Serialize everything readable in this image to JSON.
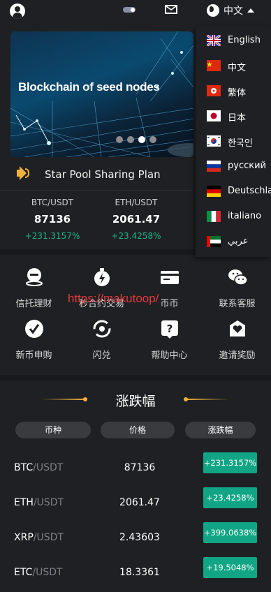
{
  "header": {
    "language_current": "中文"
  },
  "banner": {
    "title": "Blockchain of seed nodes"
  },
  "notice": {
    "text": "Star Pool Sharing Plan"
  },
  "tickers": [
    {
      "pair": "BTC/USDT",
      "price": "87136",
      "change": "+231.3157%"
    },
    {
      "pair": "ETH/USDT",
      "price": "2061.47",
      "change": "+23.4258%"
    }
  ],
  "menu": [
    {
      "label": "信托理财",
      "icon": "trust-finance-icon"
    },
    {
      "label": "秒合约交易",
      "icon": "stopwatch-icon"
    },
    {
      "label": "币币",
      "icon": "card-icon"
    },
    {
      "label": "联系客服",
      "icon": "wechat-icon"
    },
    {
      "label": "新币申购",
      "icon": "check-circle-icon"
    },
    {
      "label": "闪兑",
      "icon": "refresh-icon"
    },
    {
      "label": "帮助中心",
      "icon": "help-icon"
    },
    {
      "label": "邀请奖励",
      "icon": "invite-heart-icon"
    }
  ],
  "watermark": "https://makutoop/",
  "market": {
    "title": "涨跌幅",
    "headers": [
      "币种",
      "价格",
      "涨跌幅"
    ],
    "rows": [
      {
        "base": "BTC",
        "quote": "/USDT",
        "price": "87136",
        "change": "+231.3157%"
      },
      {
        "base": "ETH",
        "quote": "/USDT",
        "price": "2061.47",
        "change": "+23.4258%"
      },
      {
        "base": "XRP",
        "quote": "/USDT",
        "price": "2.43603",
        "change": "+399.0638%"
      },
      {
        "base": "ETC",
        "quote": "/USDT",
        "price": "18.3361",
        "change": "+19.5048%"
      }
    ]
  },
  "languages": [
    {
      "name": "English",
      "flag": "uk-flag"
    },
    {
      "name": "中文",
      "flag": "china-flag"
    },
    {
      "name": "繁体",
      "flag": "hong-kong-flag"
    },
    {
      "name": "日本",
      "flag": "japan-flag"
    },
    {
      "name": "한국인",
      "flag": "korea-flag"
    },
    {
      "name": "русский",
      "flag": "russia-flag"
    },
    {
      "name": "Deutschland",
      "flag": "germany-flag"
    },
    {
      "name": "italiano",
      "flag": "italy-flag"
    },
    {
      "name": "عربي",
      "flag": "uae-flag"
    }
  ],
  "colors": {
    "background": "#1f2023",
    "up_green": "#11a585",
    "accent_gold": "#f0b23a",
    "watermark_red": "#e23b3b"
  }
}
